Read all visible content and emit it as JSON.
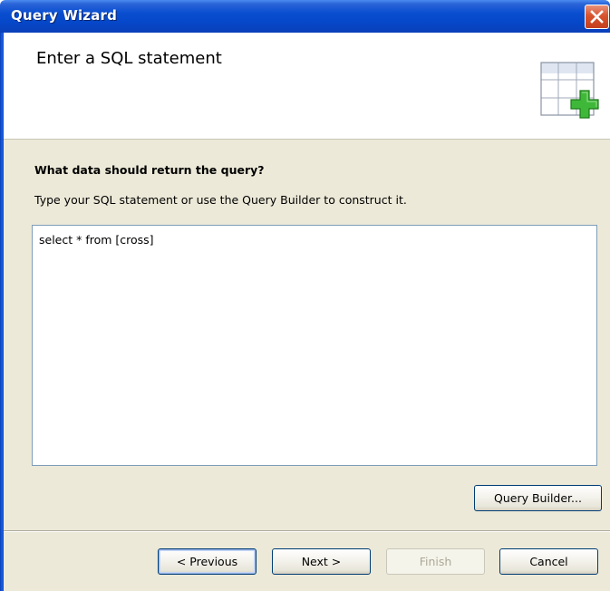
{
  "window": {
    "title": "Query Wizard"
  },
  "header": {
    "title": "Enter a SQL statement",
    "icon": "table-add-icon"
  },
  "body": {
    "question": "What data should return the query?",
    "instruction": "Type your SQL statement or use the Query Builder to construct it.",
    "sql_value": "select * from [cross]"
  },
  "buttons": {
    "query_builder": "Query Builder...",
    "previous": "< Previous",
    "next": "Next >",
    "finish": "Finish",
    "cancel": "Cancel"
  },
  "colors": {
    "titlebar": "#0547c8",
    "close_button": "#d8542e",
    "dialog_background": "#ece9d8",
    "button_border": "#003c74"
  }
}
